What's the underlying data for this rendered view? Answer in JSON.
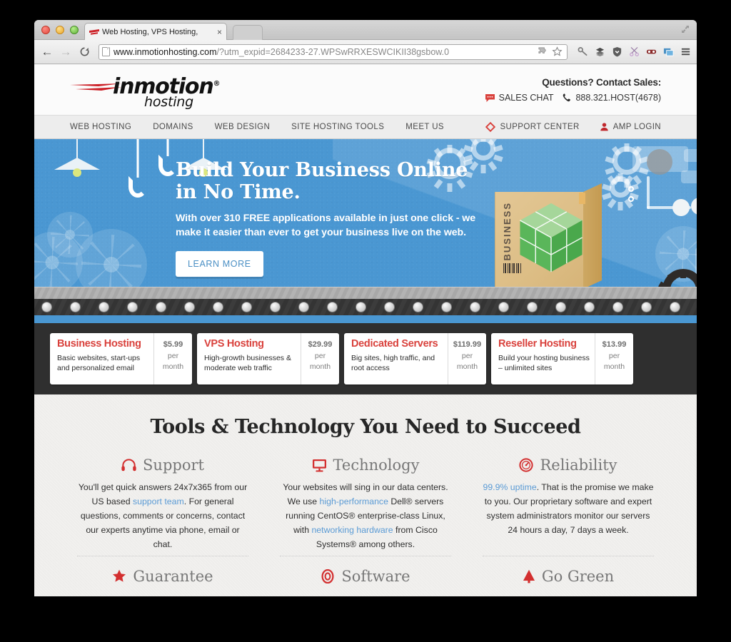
{
  "browser": {
    "tab": {
      "title": "Web Hosting, VPS Hosting,",
      "close_label": "×",
      "favicon": "inmotion-favicon"
    },
    "nav": {
      "back": "←",
      "forward": "→",
      "reload": "⟳"
    },
    "url": {
      "domain": "www.inmotionhosting.com",
      "path": "/?utm_expid=2684233-27.WPSwRRXESWCIKII38gsbow.0"
    },
    "toolbar_icons": [
      "extension-puzzle-icon",
      "bookmark-star-icon",
      "key-icon",
      "layers-icon",
      "shield-icon",
      "scissors-icon",
      "mask-icon",
      "images-icon",
      "hamburger-menu-icon"
    ],
    "window_controls": [
      "close-dot",
      "minimize-dot",
      "zoom-dot"
    ],
    "expand_icon": "fullscreen-expand-icon"
  },
  "site": {
    "logo": {
      "word": "inmotion",
      "registered": "®",
      "sub": "hosting"
    },
    "contact": {
      "heading": "Questions? Contact Sales:",
      "chat_label": "SALES CHAT",
      "chat_icon": "chat-bubble-icon",
      "phone_label": "888.321.HOST(4678)",
      "phone_icon": "phone-icon"
    },
    "nav_links": [
      {
        "label": "WEB HOSTING"
      },
      {
        "label": "DOMAINS"
      },
      {
        "label": "WEB DESIGN"
      },
      {
        "label": "SITE HOSTING TOOLS"
      },
      {
        "label": "MEET US"
      }
    ],
    "nav_right": [
      {
        "label": "SUPPORT CENTER",
        "icon": "support-ring-icon"
      },
      {
        "label": "AMP LOGIN",
        "icon": "user-icon"
      }
    ]
  },
  "hero": {
    "headline_line1": "Build Your Business Online",
    "headline_line2": "in No Time.",
    "subtext": "With over 310 FREE applications available in just one click - we make it easier than ever to get your business live on the web.",
    "cta_label": "LEARN MORE",
    "box_label": "BUSINESS",
    "bg_color": "#4a97d2",
    "cta_text_color": "#4a8fc4"
  },
  "pricing": {
    "accent_color": "#d9413c",
    "cards": [
      {
        "title": "Business Hosting",
        "desc": "Basic websites, start-ups and personalized email",
        "price": "$5.99",
        "per": "per",
        "unit": "month"
      },
      {
        "title": "VPS Hosting",
        "desc": "High-growth businesses & moderate web traffic",
        "price": "$29.99",
        "per": "per",
        "unit": "month"
      },
      {
        "title": "Dedicated Servers",
        "desc": "Big sites, high traffic, and root access",
        "price": "$119.99",
        "per": "per",
        "unit": "month"
      },
      {
        "title": "Reseller Hosting",
        "desc": "Build your hosting business – unlimited sites",
        "price": "$13.99",
        "per": "per",
        "unit": "month"
      }
    ]
  },
  "tools": {
    "heading": "Tools & Technology You Need to Succeed",
    "link_color": "#5b9bd5",
    "row1": [
      {
        "title": "Support",
        "icon": "headphones-icon",
        "text_parts": [
          {
            "t": "You'll get quick answers 24x7x365 from our US based ",
            "link": false
          },
          {
            "t": "support team",
            "link": true
          },
          {
            "t": ". For general questions, comments or concerns, contact our experts anytime via phone, email or chat.",
            "link": false
          }
        ]
      },
      {
        "title": "Technology",
        "icon": "monitor-icon",
        "text_parts": [
          {
            "t": "Your websites will sing in our data centers. We use ",
            "link": false
          },
          {
            "t": "high-performance",
            "link": true
          },
          {
            "t": " Dell® servers running CentOS® enterprise-class Linux, with ",
            "link": false
          },
          {
            "t": "networking hardware",
            "link": true
          },
          {
            "t": " from Cisco Systems® among others.",
            "link": false
          }
        ]
      },
      {
        "title": "Reliability",
        "icon": "gauge-icon",
        "text_parts": [
          {
            "t": "99.9% uptime",
            "link": true
          },
          {
            "t": ". That is the promise we make to you. Our proprietary software and expert system administrators monitor our servers 24 hours a day, 7 days a week.",
            "link": false
          }
        ]
      }
    ],
    "row2": [
      {
        "title": "Guarantee",
        "icon": "star-icon"
      },
      {
        "title": "Software",
        "icon": "target-icon"
      },
      {
        "title": "Go Green",
        "icon": "tree-icon"
      }
    ]
  }
}
